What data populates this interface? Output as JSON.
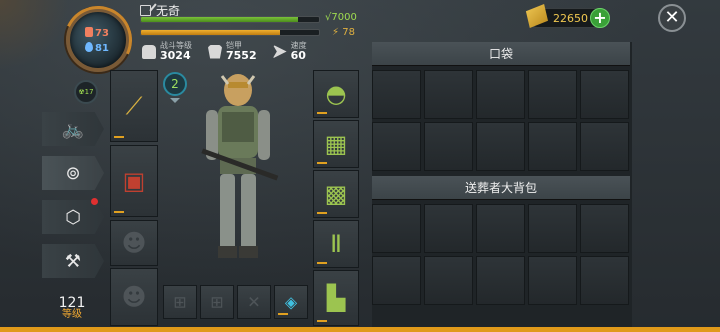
{
  "player": {
    "name": "无奇",
    "hp_value": "7000",
    "hp_fraction": 0.88,
    "energy_value": "78",
    "energy_fraction": 0.78,
    "food": "73",
    "water": "81",
    "radiation": "17"
  },
  "stats": [
    {
      "label": "战斗等级",
      "value": "3024",
      "icon": "fist-icon"
    },
    {
      "label": "铠甲",
      "value": "7552",
      "icon": "armor-icon"
    },
    {
      "label": "速度",
      "value": "60",
      "icon": "speed-icon"
    }
  ],
  "currency": {
    "gold": "22650",
    "add_label": "+"
  },
  "close_label": "✕",
  "level": {
    "number": "121",
    "label": "等级"
  },
  "loadout": {
    "selected": "2"
  },
  "side_menu": [
    {
      "name": "bike-icon",
      "glyph": "🚲"
    },
    {
      "name": "mask-icon",
      "glyph": "⊚"
    },
    {
      "name": "crate-icon",
      "glyph": "⬡"
    },
    {
      "name": "workbench-icon",
      "glyph": "⚒"
    }
  ],
  "inventory": {
    "pocket_title": "口袋",
    "backpack_title": "送葬者大背包"
  },
  "colors": {
    "accent": "#e09a1a",
    "hp": "#7ac23a",
    "energy": "#f0b030",
    "gold": "#f0c850"
  }
}
